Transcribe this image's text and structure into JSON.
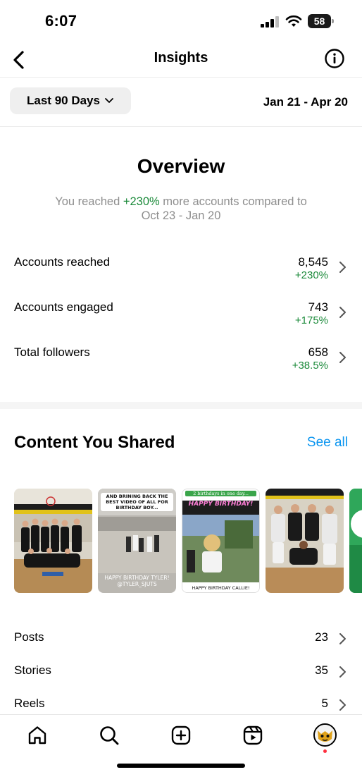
{
  "status_bar": {
    "time": "6:07",
    "battery": "58"
  },
  "nav": {
    "title": "Insights"
  },
  "date_row": {
    "period_label": "Last 90 Days",
    "date_range": "Jan 21 - Apr 20"
  },
  "overview": {
    "title": "Overview",
    "summary_prefix": "You reached ",
    "summary_change": "+230%",
    "summary_suffix": " more accounts compared to",
    "summary_period": "Oct 23 - Jan 20",
    "metrics": [
      {
        "label": "Accounts reached",
        "value": "8,545",
        "change": "+230%"
      },
      {
        "label": "Accounts engaged",
        "value": "743",
        "change": "+175%"
      },
      {
        "label": "Total followers",
        "value": "658",
        "change": "+38.5%"
      }
    ]
  },
  "content": {
    "title": "Content You Shared",
    "see_all": "See all",
    "thumbnails": [
      {
        "caption_top": "",
        "caption_bottom": ""
      },
      {
        "caption_top": "AND BRINING BACK THE BEST VIDEO OF ALL FOR BIRTHDAY BOY...",
        "caption_bottom": "HAPPY BIRTHDAY TYLER! @TYLER_SJUTS"
      },
      {
        "caption_top": "2 birthdays in one day...",
        "caption_title": "HAPPY BIRTHDAY!",
        "caption_bottom": "HAPPY BIRTHDAY CALLIE!"
      },
      {
        "caption_top": "",
        "caption_bottom": ""
      },
      {
        "caption_top": "",
        "caption_bottom": ""
      }
    ],
    "rows": [
      {
        "label": "Posts",
        "value": "23"
      },
      {
        "label": "Stories",
        "value": "35"
      },
      {
        "label": "Reels",
        "value": "5"
      }
    ]
  },
  "colors": {
    "positive": "#1b8a3a",
    "link": "#0a95f0",
    "chip_bg": "#efefef"
  }
}
